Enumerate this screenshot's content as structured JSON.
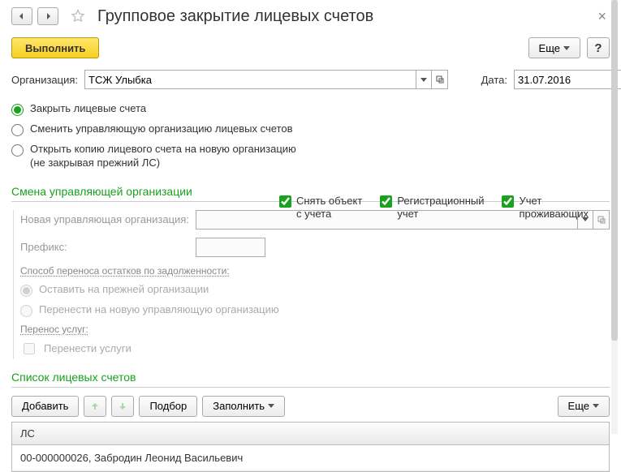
{
  "title": "Групповое закрытие лицевых счетов",
  "buttons": {
    "execute": "Выполнить",
    "more": "Еще",
    "help": "?",
    "add": "Добавить",
    "select": "Подбор",
    "fill": "Заполнить"
  },
  "fields": {
    "org_label": "Организация:",
    "org_value": "ТСЖ Улыбка",
    "date_label": "Дата:",
    "date_value": "31.07.2016",
    "new_org_label": "Новая управляющая организация:",
    "new_org_value": "",
    "prefix_label": "Префикс:",
    "prefix_value": ""
  },
  "radios": {
    "action": [
      "Закрыть лицевые счета",
      "Сменить управляющую организацию лицевых счетов",
      "Открыть копию лицевого счета на новую организацию\n(не закрывая прежний ЛС)"
    ],
    "debt": [
      "Оставить на прежней организации",
      "Перенести на новую управляющую организацию"
    ]
  },
  "checkboxes": {
    "deregister": "Снять объект с учета",
    "reg_uchet": "Регистрационный учет",
    "residents": "Учет проживающих",
    "transfer_services": "Перенести услуги"
  },
  "sections": {
    "change_org": "Смена управляющей организации",
    "debt_method": "Способ переноса остатков по задолженности:",
    "service_transfer": "Перенос услуг:",
    "accounts_list": "Список лицевых счетов"
  },
  "table": {
    "header": "ЛС",
    "rows": [
      "00-000000026, Забродин Леонид Васильевич"
    ]
  }
}
